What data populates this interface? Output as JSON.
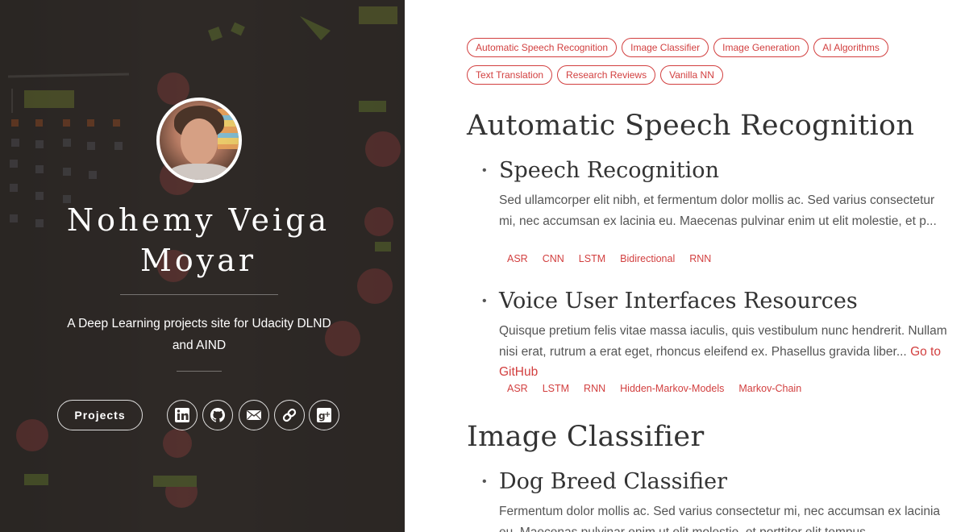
{
  "sidebar": {
    "name_line1": "Nohemy Veiga",
    "name_line2": "Moyar",
    "tagline": "A Deep Learning projects site for Udacity DLND and AIND",
    "projects_label": "Projects",
    "social": [
      {
        "icon": "linkedin-icon"
      },
      {
        "icon": "github-icon"
      },
      {
        "icon": "email-icon"
      },
      {
        "icon": "link-icon"
      },
      {
        "icon": "google-plus-icon"
      }
    ]
  },
  "tags": [
    "Automatic Speech Recognition",
    "Image Classifier",
    "Image Generation",
    "AI Algorithms",
    "Text Translation",
    "Research Reviews",
    "Vanilla NN"
  ],
  "sections": [
    {
      "title": "Automatic Speech Recognition",
      "posts": [
        {
          "title": "Speech Recognition",
          "excerpt": "Sed ullamcorper elit nibh, et fermentum dolor mollis ac. Sed varius consectetur mi, nec accumsan ex lacinia eu. Maecenas pulvinar enim ut elit molestie, et p...",
          "tags": [
            "ASR",
            "CNN",
            "LSTM",
            "Bidirectional",
            "RNN"
          ]
        },
        {
          "title": "Voice User Interfaces Resources",
          "excerpt": "Quisque pretium felis vitae massa iaculis, quis vestibulum nunc hendrerit. Nullam nisi erat, rutrum a erat eget, rhoncus eleifend ex. Phasellus gravida liber...",
          "link": "Go to GitHub",
          "tags": [
            "ASR",
            "LSTM",
            "RNN",
            "Hidden-Markov-Models",
            "Markov-Chain"
          ]
        }
      ]
    },
    {
      "title": "Image Classifier",
      "posts": [
        {
          "title": "Dog Breed Classifier",
          "excerpt": "Fermentum dolor mollis ac. Sed varius consectetur mi, nec accumsan ex lacinia eu. Maecenas pulvinar enim ut elit molestie, et porttitor elit tempus"
        }
      ]
    }
  ],
  "colors": {
    "accent": "#d23f3f",
    "sidebar_bg": "#2f2a27",
    "text": "#444444"
  }
}
